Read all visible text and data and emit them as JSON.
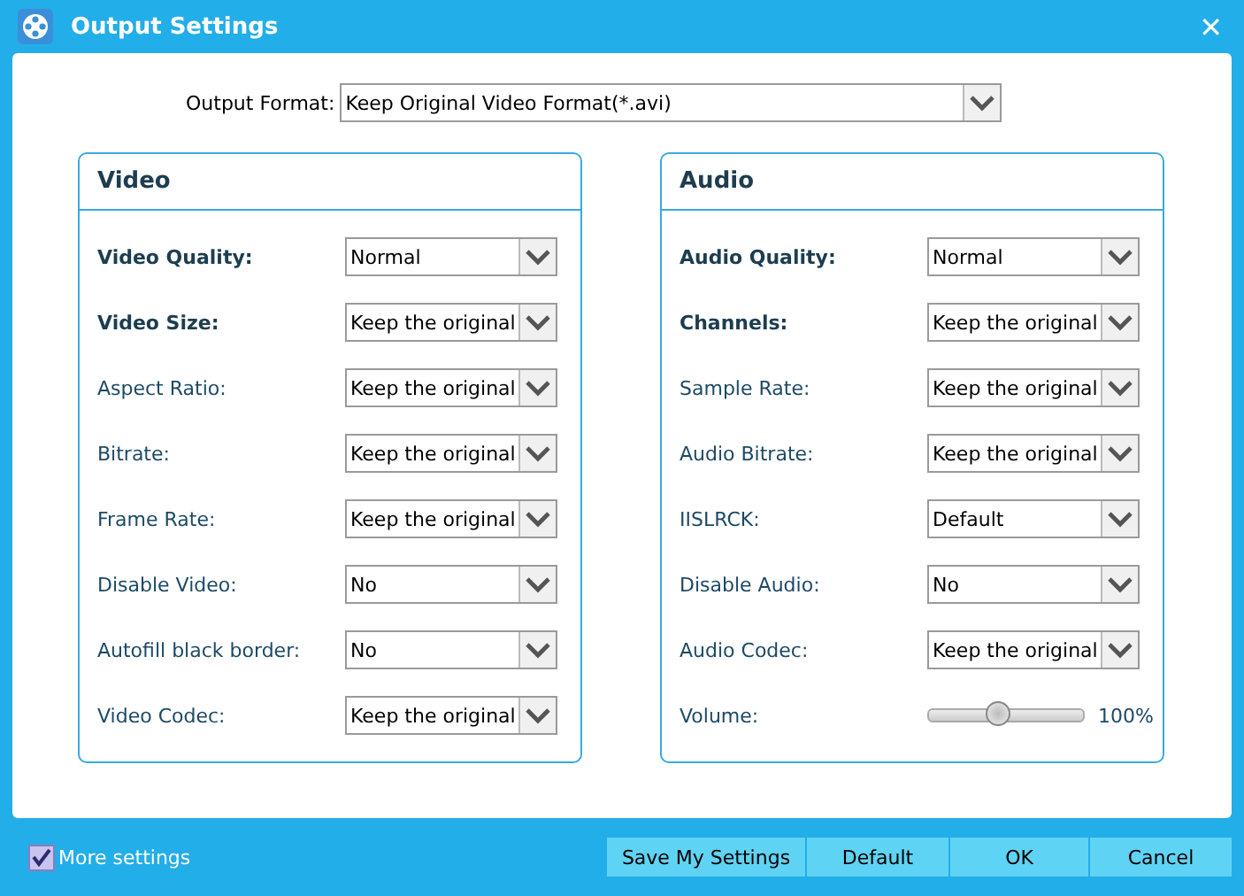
{
  "window": {
    "title": "Output Settings",
    "close": "✕"
  },
  "output_format": {
    "label": "Output Format:",
    "value": "Keep Original Video Format(*.avi)"
  },
  "panels": [
    {
      "title": "Video",
      "rows": [
        {
          "kind": "combo",
          "label": "Video Quality:",
          "bold": true,
          "value": "Normal"
        },
        {
          "kind": "combo",
          "label": "Video Size:",
          "bold": true,
          "value": "Keep the original"
        },
        {
          "kind": "combo",
          "label": "Aspect Ratio:",
          "bold": false,
          "value": "Keep the original"
        },
        {
          "kind": "combo",
          "label": "Bitrate:",
          "bold": false,
          "value": "Keep the original"
        },
        {
          "kind": "combo",
          "label": "Frame Rate:",
          "bold": false,
          "value": "Keep the original"
        },
        {
          "kind": "combo",
          "label": "Disable Video:",
          "bold": false,
          "value": "No"
        },
        {
          "kind": "combo",
          "label": "Autofill black border:",
          "bold": false,
          "value": "No"
        },
        {
          "kind": "combo",
          "label": "Video Codec:",
          "bold": false,
          "value": "Keep the original"
        }
      ]
    },
    {
      "title": "Audio",
      "rows": [
        {
          "kind": "combo",
          "label": "Audio Quality:",
          "bold": true,
          "value": "Normal"
        },
        {
          "kind": "combo",
          "label": "Channels:",
          "bold": true,
          "value": "Keep the original"
        },
        {
          "kind": "combo",
          "label": "Sample Rate:",
          "bold": false,
          "value": "Keep the original"
        },
        {
          "kind": "combo",
          "label": "Audio Bitrate:",
          "bold": false,
          "value": "Keep the original"
        },
        {
          "kind": "combo",
          "label": "IISLRCK:",
          "bold": false,
          "value": "Default"
        },
        {
          "kind": "combo",
          "label": "Disable Audio:",
          "bold": false,
          "value": "No"
        },
        {
          "kind": "combo",
          "label": "Audio Codec:",
          "bold": false,
          "value": "Keep the original"
        },
        {
          "kind": "slider",
          "label": "Volume:",
          "bold": false,
          "level": 0.45,
          "reading": "100%"
        }
      ]
    }
  ],
  "more_settings": {
    "label": "More settings",
    "checked": true
  },
  "buttons": [
    "Save My Settings",
    "Default",
    "OK",
    "Cancel"
  ]
}
